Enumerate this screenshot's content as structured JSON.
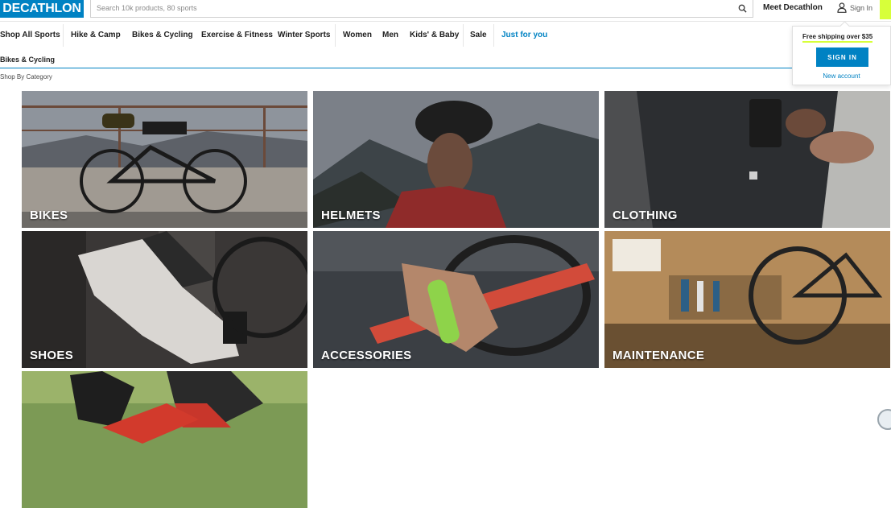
{
  "header": {
    "logo": "DECATHLON",
    "search_placeholder": "Search 10k products, 80 sports",
    "meet": "Meet Decathlon",
    "sign_in": "Sign In"
  },
  "nav": {
    "items": [
      {
        "label": "Shop All Sports"
      },
      {
        "label": "Hike & Camp"
      },
      {
        "label": "Bikes & Cycling"
      },
      {
        "label": "Exercise & Fitness"
      },
      {
        "label": "Winter Sports"
      },
      {
        "label": "Women"
      },
      {
        "label": "Men"
      },
      {
        "label": "Kids' & Baby"
      },
      {
        "label": "Sale"
      },
      {
        "label": "Just for you"
      }
    ]
  },
  "breadcrumb": {
    "title": "Bikes & Cycling",
    "subtitle": "Shop By Category"
  },
  "popover": {
    "shipping": "Free shipping over $35",
    "sign_in_button": "SIGN IN",
    "new_account": "New account"
  },
  "categories": [
    {
      "label": "BIKES"
    },
    {
      "label": "HELMETS"
    },
    {
      "label": "CLOTHING"
    },
    {
      "label": "SHOES"
    },
    {
      "label": "ACCESSORIES"
    },
    {
      "label": "MAINTENANCE"
    },
    {
      "label": ""
    }
  ],
  "colors": {
    "brand_blue": "#0082c3",
    "accent_lime": "#d7ff3a"
  }
}
